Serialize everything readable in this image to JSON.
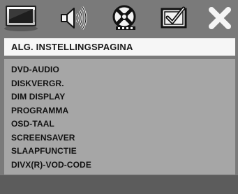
{
  "toolbar": {
    "icons": [
      {
        "name": "general-setup-icon",
        "selected": true
      },
      {
        "name": "audio-setup-icon"
      },
      {
        "name": "video-setup-icon"
      },
      {
        "name": "preference-setup-icon"
      },
      {
        "name": "exit-icon"
      }
    ]
  },
  "page_title": "ALG. INSTELLINGSPAGINA",
  "menu": {
    "items": [
      {
        "label": "DVD-AUDIO"
      },
      {
        "label": "DISKVERGR."
      },
      {
        "label": "DIM DISPLAY"
      },
      {
        "label": "PROGRAMMA"
      },
      {
        "label": "OSD-TAAL"
      },
      {
        "label": "SCREENSAVER"
      },
      {
        "label": "SLAAPFUNCTIE"
      },
      {
        "label": "DIVX(R)-VOD-CODE"
      }
    ]
  },
  "colors": {
    "background": "#7a7a7a",
    "title_bar": "#f6f6f6",
    "menu_panel": "#a6a6a6",
    "bottom_bar": "#5c5c5c",
    "menu_text": "#111111"
  }
}
